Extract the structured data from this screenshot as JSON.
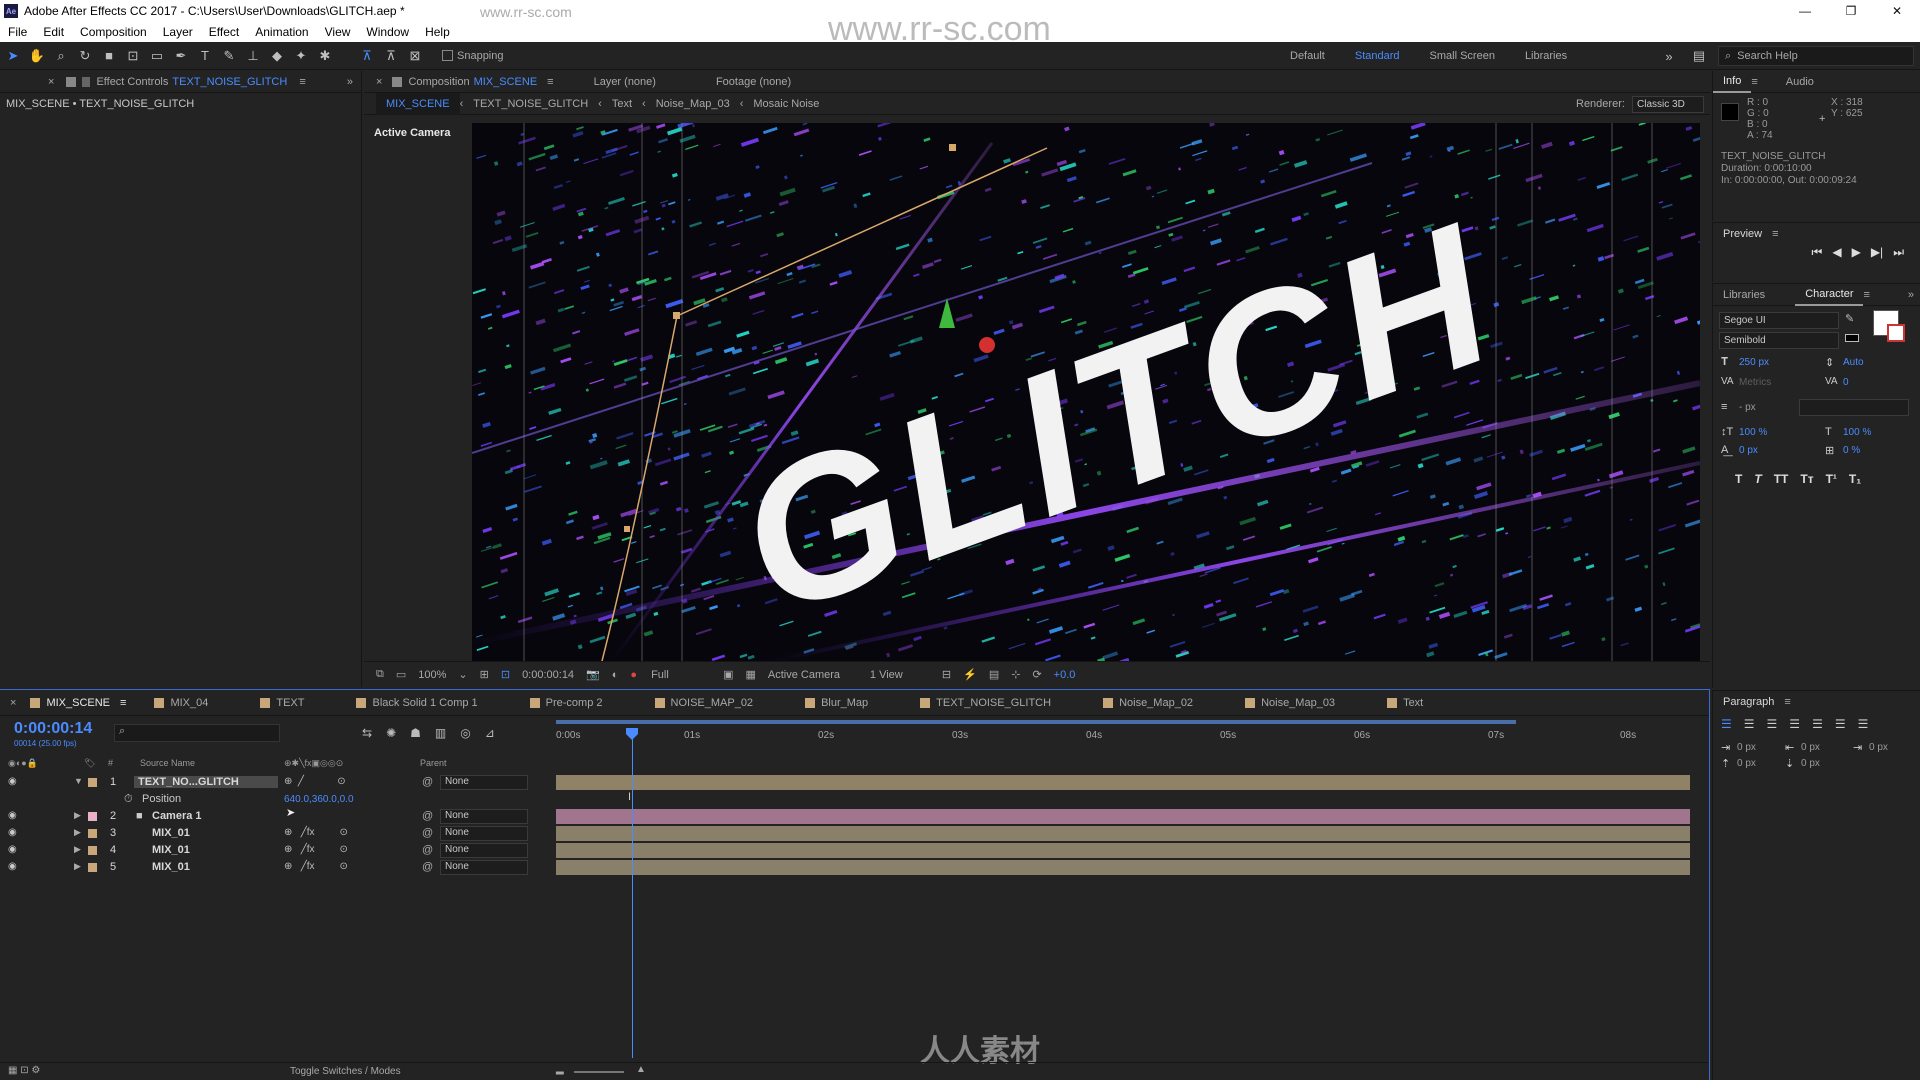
{
  "titlebar": {
    "logo": "Ae",
    "title": "Adobe After Effects CC 2017 - C:\\Users\\User\\Downloads\\GLITCH.aep *",
    "minimize": "—",
    "restore": "❐",
    "close": "✕"
  },
  "watermark": {
    "url1": "www.rr-sc.com",
    "url_big": "www.rr-sc.com",
    "brand": "人人素材"
  },
  "menu": [
    "File",
    "Edit",
    "Composition",
    "Layer",
    "Effect",
    "Animation",
    "View",
    "Window",
    "Help"
  ],
  "toolbar": {
    "snapping": "Snapping",
    "workspaces": [
      "Default",
      "Standard",
      "Small Screen",
      "Libraries"
    ],
    "search_placeholder": "Search Help"
  },
  "effect_panel": {
    "tab_prefix": "Effect Controls",
    "tab_layer": "TEXT_NOISE_GLITCH",
    "path": "MIX_SCENE • TEXT_NOISE_GLITCH"
  },
  "comp_panel": {
    "tab_prefix": "Composition",
    "tab_comp": "MIX_SCENE",
    "layer_tab": "Layer (none)",
    "footage_tab": "Footage (none)",
    "breadcrumbs": [
      "MIX_SCENE",
      "TEXT_NOISE_GLITCH",
      "Text",
      "Noise_Map_03",
      "Mosaic Noise"
    ],
    "renderer_label": "Renderer:",
    "renderer_value": "Classic 3D",
    "active_camera_label": "Active Camera",
    "canvas_text": "GLITCH",
    "footer": {
      "zoom": "100%",
      "timecode": "0:00:00:14",
      "resolution": "Full",
      "view": "Active Camera",
      "views": "1 View",
      "exposure": "+0.0"
    }
  },
  "info_panel": {
    "tabs": [
      "Info",
      "Audio"
    ],
    "r": "R : 0",
    "g": "G : 0",
    "b": "B : 0",
    "a": "A : 74",
    "x": "X : 318",
    "y": "Y : 625",
    "layer_name": "TEXT_NOISE_GLITCH",
    "duration": "Duration: 0:00:10:00",
    "in_out": "In: 0:00:00:00, Out: 0:00:09:24"
  },
  "preview_panel": {
    "title": "Preview"
  },
  "character_panel": {
    "tabs": [
      "Libraries",
      "Character"
    ],
    "font": "Segoe UI",
    "style": "Semibold",
    "size": "250 px",
    "leading": "Auto",
    "kerning": "Metrics",
    "tracking": "0",
    "stroke": "- px",
    "vscale": "100 %",
    "hscale": "100 %",
    "baseline": "0 px",
    "tsume": "0 %",
    "styles": [
      "T",
      "T",
      "TT",
      "Tт",
      "T¹",
      "T₁"
    ]
  },
  "paragraph_panel": {
    "title": "Paragraph",
    "indent_left": "0 px",
    "indent_first": "0 px",
    "indent_right": "0 px",
    "space_before": "0 px",
    "space_after": "0 px"
  },
  "timeline": {
    "tabs": [
      "MIX_SCENE",
      "MIX_04",
      "TEXT",
      "Black Solid 1 Comp 1",
      "Pre-comp 2",
      "NOISE_MAP_02",
      "Blur_Map",
      "TEXT_NOISE_GLITCH",
      "Noise_Map_02",
      "Noise_Map_03",
      "Text"
    ],
    "tab_colors": [
      "#c8a87a",
      "#c8a87a",
      "#c8a87a",
      "#c8a87a",
      "#c8a87a",
      "#c8a87a",
      "#c8a87a",
      "#c8a87a",
      "#c8a87a",
      "#c8a87a",
      "#c8a87a"
    ],
    "timecode": "0:00:00:14",
    "fps": "00014 (25.00 fps)",
    "ruler": [
      "0:00s",
      "01s",
      "02s",
      "03s",
      "04s",
      "05s",
      "06s",
      "07s",
      "08s"
    ],
    "header": {
      "num": "#",
      "source": "Source Name",
      "parent": "Parent"
    },
    "layers": [
      {
        "num": "1",
        "name": "TEXT_NO...GLITCH",
        "parent": "None",
        "color": "#c8a87a",
        "bar": "#8f8266"
      },
      {
        "num": "2",
        "name": "Camera 1",
        "parent": "None",
        "color": "#e9b0c8",
        "bar": "#a2758e"
      },
      {
        "num": "3",
        "name": "MIX_01",
        "parent": "None",
        "color": "#c8a87a",
        "bar": "#8a7f68"
      },
      {
        "num": "4",
        "name": "MIX_01",
        "parent": "None",
        "color": "#c8a87a",
        "bar": "#8a7f68"
      },
      {
        "num": "5",
        "name": "MIX_01",
        "parent": "None",
        "color": "#c8a87a",
        "bar": "#8a7f68"
      }
    ],
    "position_prop": "Position",
    "position_value": "640.0,360.0,0.0",
    "toggle_label": "Toggle Switches / Modes"
  },
  "colors": {
    "accent": "#4a8cff",
    "panel": "#232323",
    "playhead": "#4a8cff"
  }
}
